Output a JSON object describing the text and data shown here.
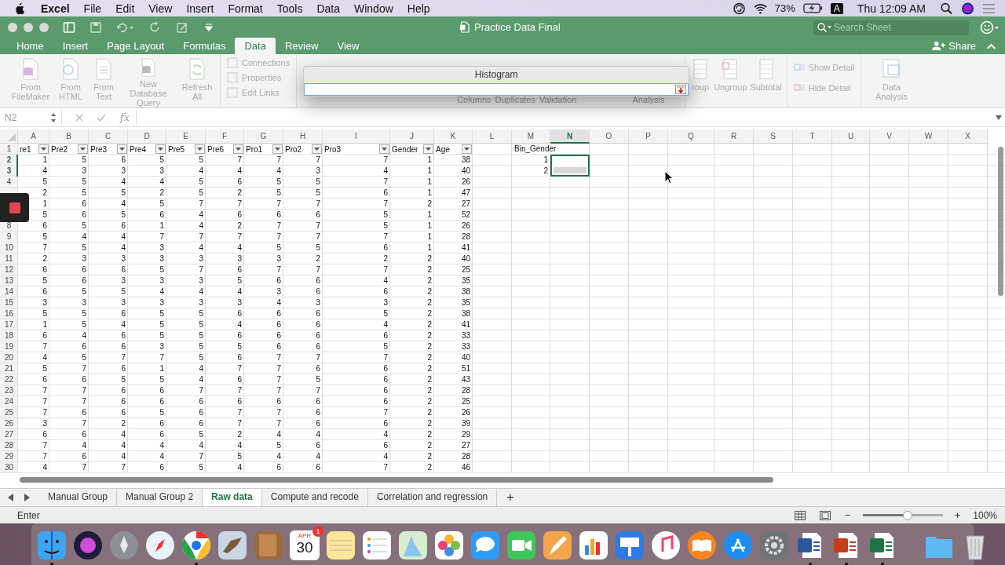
{
  "menu_bar": {
    "app": "Excel",
    "items": [
      "File",
      "Edit",
      "View",
      "Insert",
      "Format",
      "Tools",
      "Data",
      "Window",
      "Help"
    ],
    "battery": "73%",
    "input_source": "A",
    "clock": "Thu 12:09 AM"
  },
  "window": {
    "title": "Practice Data Final",
    "search": {
      "placeholder": "Search Sheet"
    },
    "share": "Share"
  },
  "ribbon_tabs": [
    {
      "label": "Home",
      "selected": false
    },
    {
      "label": "Insert",
      "selected": false
    },
    {
      "label": "Page Layout",
      "selected": false
    },
    {
      "label": "Formulas",
      "selected": false
    },
    {
      "label": "Data",
      "selected": true
    },
    {
      "label": "Review",
      "selected": false
    },
    {
      "label": "View",
      "selected": false
    }
  ],
  "ribbon": {
    "left_buttons": [
      {
        "label": "From FileMaker",
        "disabled": true
      },
      {
        "label": "From HTML",
        "disabled": true
      },
      {
        "label": "From Text",
        "disabled": true
      },
      {
        "label": "New Database Query",
        "disabled": true
      },
      {
        "label": "Refresh All",
        "disabled": true
      }
    ],
    "connection_items": [
      {
        "label": "Connections",
        "disabled": true
      },
      {
        "label": "Properties",
        "disabled": true
      },
      {
        "label": "Edit Links",
        "disabled": true
      }
    ],
    "covered_labels": [
      "Columns",
      "Duplicates",
      "Validation"
    ],
    "covered_label_right": "Analysis",
    "outline_buttons": [
      {
        "label": "roup",
        "disabled": true
      },
      {
        "label": "Ungroup",
        "disabled": true
      },
      {
        "label": "Subtotal",
        "disabled": true
      }
    ],
    "detail_items": [
      {
        "label": "Show Detail",
        "disabled": true
      },
      {
        "label": "Hide Detail",
        "disabled": true
      }
    ],
    "analysis_button": {
      "label": "Data Analysis",
      "disabled": true
    }
  },
  "dialog": {
    "title": "Histogram"
  },
  "formula_bar": {
    "name_box": "N2",
    "fx": "fx"
  },
  "sheet": {
    "columns": [
      {
        "letter": "A",
        "selected": false
      },
      {
        "letter": "B",
        "selected": false
      },
      {
        "letter": "C",
        "selected": false
      },
      {
        "letter": "D",
        "selected": false
      },
      {
        "letter": "E",
        "selected": false
      },
      {
        "letter": "F",
        "selected": false
      },
      {
        "letter": "G",
        "selected": false
      },
      {
        "letter": "H",
        "selected": false
      },
      {
        "letter": "I",
        "selected": false
      },
      {
        "letter": "J",
        "selected": false
      },
      {
        "letter": "K",
        "selected": false
      },
      {
        "letter": "L",
        "selected": false
      },
      {
        "letter": "M",
        "selected": false
      },
      {
        "letter": "N",
        "selected": true
      },
      {
        "letter": "O",
        "selected": false
      },
      {
        "letter": "P",
        "selected": false
      },
      {
        "letter": "Q",
        "selected": false
      },
      {
        "letter": "R",
        "selected": false
      },
      {
        "letter": "S",
        "selected": false
      },
      {
        "letter": "T",
        "selected": false
      },
      {
        "letter": "U",
        "selected": false
      },
      {
        "letter": "V",
        "selected": false
      },
      {
        "letter": "W",
        "selected": false
      },
      {
        "letter": "X",
        "selected": false
      }
    ],
    "header_row": {
      "number": "1",
      "headers": [
        "re1",
        "Pre2",
        "Pre3",
        "Pre4",
        "Pre5",
        "Pre6",
        "Pro1",
        "Pro2",
        "Pro3",
        "Gender",
        "Age"
      ],
      "bin_label": "Bin_Gender"
    },
    "rows": [
      {
        "number": "2",
        "selected": true,
        "values": [
          "1",
          "5",
          "6",
          "5",
          "5",
          "7",
          "7",
          "7",
          "7",
          "1",
          "38"
        ],
        "bin": "1"
      },
      {
        "number": "3",
        "selected": true,
        "values": [
          "4",
          "3",
          "3",
          "3",
          "4",
          "4",
          "4",
          "3",
          "4",
          "1",
          "40"
        ],
        "bin": "2"
      },
      {
        "number": "4",
        "selected": false,
        "values": [
          "5",
          "5",
          "4",
          "4",
          "5",
          "6",
          "5",
          "5",
          "7",
          "1",
          "26"
        ]
      },
      {
        "selected": false,
        "values": [
          "2",
          "5",
          "5",
          "2",
          "5",
          "2",
          "5",
          "5",
          "6",
          "1",
          "47"
        ]
      },
      {
        "selected": false,
        "values": [
          "1",
          "6",
          "4",
          "5",
          "7",
          "7",
          "7",
          "7",
          "7",
          "2",
          "27"
        ]
      },
      {
        "selected": false,
        "values": [
          "5",
          "6",
          "5",
          "6",
          "4",
          "6",
          "6",
          "6",
          "5",
          "1",
          "52"
        ]
      },
      {
        "number": "8",
        "selected": false,
        "values": [
          "6",
          "5",
          "6",
          "1",
          "4",
          "2",
          "7",
          "7",
          "5",
          "1",
          "26"
        ]
      },
      {
        "number": "9",
        "selected": false,
        "values": [
          "5",
          "4",
          "4",
          "7",
          "7",
          "7",
          "7",
          "7",
          "7",
          "1",
          "28"
        ]
      },
      {
        "number": "10",
        "selected": false,
        "values": [
          "7",
          "5",
          "4",
          "3",
          "4",
          "4",
          "5",
          "5",
          "6",
          "1",
          "41"
        ]
      },
      {
        "number": "11",
        "selected": false,
        "values": [
          "2",
          "3",
          "3",
          "3",
          "3",
          "3",
          "3",
          "2",
          "2",
          "2",
          "40"
        ]
      },
      {
        "number": "12",
        "selected": false,
        "values": [
          "6",
          "6",
          "6",
          "5",
          "7",
          "6",
          "7",
          "7",
          "7",
          "2",
          "25"
        ]
      },
      {
        "number": "13",
        "selected": false,
        "values": [
          "5",
          "6",
          "3",
          "3",
          "3",
          "5",
          "6",
          "6",
          "4",
          "2",
          "35"
        ]
      },
      {
        "number": "14",
        "selected": false,
        "values": [
          "6",
          "5",
          "5",
          "4",
          "4",
          "4",
          "3",
          "6",
          "6",
          "2",
          "38"
        ]
      },
      {
        "number": "15",
        "selected": false,
        "values": [
          "3",
          "3",
          "3",
          "3",
          "3",
          "3",
          "4",
          "3",
          "3",
          "2",
          "35"
        ]
      },
      {
        "number": "16",
        "selected": false,
        "values": [
          "5",
          "5",
          "6",
          "5",
          "5",
          "6",
          "6",
          "6",
          "5",
          "2",
          "38"
        ]
      },
      {
        "number": "17",
        "selected": false,
        "values": [
          "1",
          "5",
          "4",
          "5",
          "5",
          "4",
          "6",
          "6",
          "4",
          "2",
          "41"
        ]
      },
      {
        "number": "18",
        "selected": false,
        "values": [
          "6",
          "4",
          "6",
          "5",
          "5",
          "6",
          "6",
          "6",
          "6",
          "2",
          "33"
        ]
      },
      {
        "number": "19",
        "selected": false,
        "values": [
          "7",
          "6",
          "6",
          "3",
          "5",
          "5",
          "6",
          "6",
          "5",
          "2",
          "33"
        ]
      },
      {
        "number": "20",
        "selected": false,
        "values": [
          "4",
          "5",
          "7",
          "7",
          "5",
          "6",
          "7",
          "7",
          "7",
          "2",
          "40"
        ]
      },
      {
        "number": "21",
        "selected": false,
        "values": [
          "5",
          "7",
          "6",
          "1",
          "4",
          "7",
          "7",
          "6",
          "6",
          "2",
          "51"
        ]
      },
      {
        "number": "22",
        "selected": false,
        "values": [
          "6",
          "6",
          "5",
          "5",
          "4",
          "6",
          "7",
          "5",
          "6",
          "2",
          "43"
        ]
      },
      {
        "number": "23",
        "selected": false,
        "values": [
          "7",
          "7",
          "6",
          "6",
          "7",
          "7",
          "7",
          "7",
          "6",
          "2",
          "28"
        ]
      },
      {
        "number": "24",
        "selected": false,
        "values": [
          "7",
          "7",
          "6",
          "6",
          "6",
          "6",
          "6",
          "6",
          "6",
          "2",
          "25"
        ]
      },
      {
        "number": "25",
        "selected": false,
        "values": [
          "7",
          "6",
          "6",
          "5",
          "6",
          "7",
          "7",
          "6",
          "7",
          "2",
          "26"
        ]
      },
      {
        "number": "26",
        "selected": false,
        "values": [
          "3",
          "7",
          "2",
          "6",
          "6",
          "7",
          "7",
          "6",
          "6",
          "2",
          "39"
        ]
      },
      {
        "number": "27",
        "selected": false,
        "values": [
          "6",
          "6",
          "4",
          "6",
          "5",
          "2",
          "4",
          "4",
          "4",
          "2",
          "29"
        ]
      },
      {
        "number": "28",
        "selected": false,
        "values": [
          "7",
          "4",
          "4",
          "4",
          "4",
          "4",
          "5",
          "6",
          "6",
          "2",
          "27"
        ]
      },
      {
        "number": "29",
        "selected": false,
        "values": [
          "7",
          "6",
          "4",
          "4",
          "7",
          "5",
          "4",
          "4",
          "4",
          "2",
          "28"
        ]
      },
      {
        "number": "30",
        "selected": false,
        "values": [
          "4",
          "7",
          "7",
          "6",
          "5",
          "4",
          "6",
          "6",
          "7",
          "2",
          "46"
        ]
      }
    ]
  },
  "sheet_tabs": {
    "tabs": [
      {
        "label": "Manual Group",
        "selected": false
      },
      {
        "label": "Manual Group 2",
        "selected": false
      },
      {
        "label": "Raw data",
        "selected": true
      },
      {
        "label": "Compute and recode",
        "selected": false
      },
      {
        "label": "Correlation and regression",
        "selected": false
      }
    ],
    "add": "+"
  },
  "status_bar": {
    "mode": "Enter",
    "zoom_minus": "−",
    "zoom_plus": "+",
    "zoom": {
      "level": 0.55
    },
    "zoom_reading": "100%"
  },
  "dock": {
    "calendar": {
      "month": "APR",
      "day": "30",
      "badge": "1"
    }
  }
}
